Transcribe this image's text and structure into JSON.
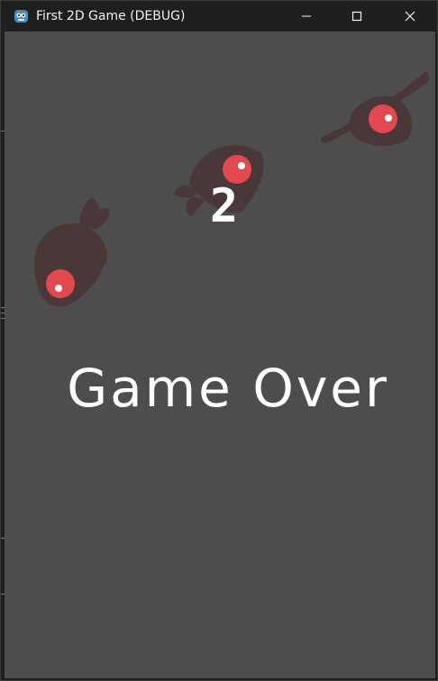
{
  "window": {
    "title": "First 2D Game (DEBUG)",
    "icon": "godot-icon",
    "controls": {
      "minimize_icon": "minimize-icon",
      "maximize_icon": "maximize-icon",
      "close_icon": "close-icon"
    }
  },
  "game": {
    "score": "2",
    "message": "Game Over",
    "background_color": "#4d4d4d",
    "enemy_body_color": "#4a3838",
    "enemy_eye_color": "#e1494f"
  }
}
